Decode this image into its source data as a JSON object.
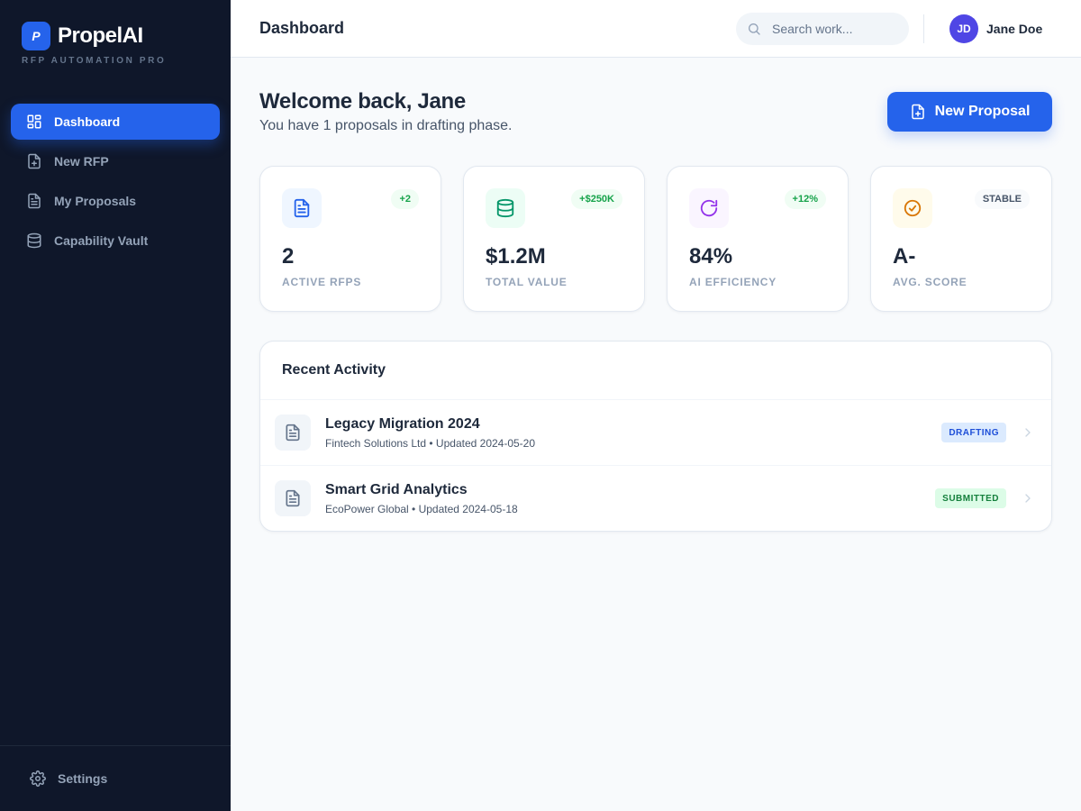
{
  "brand": {
    "mark": "P",
    "name": "PropelAI",
    "subtitle": "RFP AUTOMATION PRO"
  },
  "sidebar": {
    "items": [
      {
        "label": "Dashboard",
        "icon": "dashboard-grid-icon",
        "active": true
      },
      {
        "label": "New RFP",
        "icon": "file-plus-icon",
        "active": false
      },
      {
        "label": "My Proposals",
        "icon": "file-text-icon",
        "active": false
      },
      {
        "label": "Capability Vault",
        "icon": "database-icon",
        "active": false
      }
    ],
    "footer": {
      "label": "Settings",
      "icon": "gear-icon"
    }
  },
  "header": {
    "title": "Dashboard",
    "search": {
      "placeholder": "Search work...",
      "value": ""
    },
    "user": {
      "initials": "JD",
      "name": "Jane Doe"
    }
  },
  "main": {
    "welcome": "Welcome back, Jane",
    "subtitle": "You have 1 proposals in drafting phase.",
    "new_proposal_label": "New Proposal"
  },
  "stats": [
    {
      "value": "2",
      "label": "ACTIVE RFPS",
      "badge": "+2",
      "icon": "file-text-icon",
      "icon_color": "#2563eb",
      "icon_bg": "#eff6ff",
      "badge_color": "#16a34a",
      "badge_bg": "#f0fdf4"
    },
    {
      "value": "$1.2M",
      "label": "TOTAL VALUE",
      "badge": "+$250K",
      "icon": "database-icon",
      "icon_color": "#059669",
      "icon_bg": "#ecfdf5",
      "badge_color": "#16a34a",
      "badge_bg": "#f0fdf4"
    },
    {
      "value": "84%",
      "label": "AI EFFICIENCY",
      "badge": "+12%",
      "icon": "refresh-icon",
      "icon_color": "#9333ea",
      "icon_bg": "#faf5ff",
      "badge_color": "#16a34a",
      "badge_bg": "#f0fdf4"
    },
    {
      "value": "A-",
      "label": "AVG. SCORE",
      "badge": "STABLE",
      "icon": "check-circle-icon",
      "icon_color": "#d97706",
      "icon_bg": "#fffbeb",
      "badge_color": "#475569",
      "badge_bg": "#f8fafc"
    }
  ],
  "activity": {
    "title": "Recent Activity",
    "rows": [
      {
        "title": "Legacy Migration 2024",
        "meta": "Fintech Solutions Ltd • Updated 2024-05-20",
        "status": "DRAFTING",
        "status_color": "#1d4ed8",
        "status_bg": "#dbeafe"
      },
      {
        "title": "Smart Grid Analytics",
        "meta": "EcoPower Global • Updated 2024-05-18",
        "status": "SUBMITTED",
        "status_color": "#15803d",
        "status_bg": "#dcfce7"
      }
    ]
  },
  "colors": {
    "accent": "#2563eb",
    "sidebar_bg": "#0f172a",
    "avatar_bg": "#4f46e5"
  }
}
